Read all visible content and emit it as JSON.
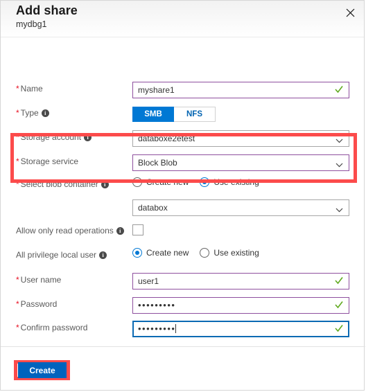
{
  "header": {
    "title": "Add share",
    "subtitle": "mydbg1",
    "close_icon": "close-icon"
  },
  "fields": {
    "name": {
      "label": "Name",
      "required": true,
      "value": "myshare1",
      "placeholder": ""
    },
    "type": {
      "label": "Type",
      "required": true,
      "has_info": true,
      "options": [
        "SMB",
        "NFS"
      ],
      "selected": "SMB"
    },
    "storage_account": {
      "label": "Storage account",
      "required": true,
      "has_info": true,
      "value": "databoxe2etest"
    },
    "storage_service": {
      "label": "Storage service",
      "required": true,
      "has_info": false,
      "value": "Block Blob"
    },
    "blob_container": {
      "label": "Select blob container",
      "required": true,
      "has_info": true,
      "radio_options": [
        "Create new",
        "Use existing"
      ],
      "selected_radio": "Use existing",
      "value": "databox"
    },
    "read_only": {
      "label": "Allow only read operations",
      "required": false,
      "has_info": true,
      "checked": false
    },
    "local_user": {
      "label": "All privilege local user",
      "required": false,
      "has_info": true,
      "radio_options": [
        "Create new",
        "Use existing"
      ],
      "selected_radio": "Create new"
    },
    "user_name": {
      "label": "User name",
      "required": true,
      "value": "user1"
    },
    "password": {
      "label": "Password",
      "required": true,
      "value": "•••••••••"
    },
    "confirm_password": {
      "label": "Confirm password",
      "required": true,
      "value": "•••••••••"
    }
  },
  "footer": {
    "create_label": "Create"
  },
  "colors": {
    "accent_blue": "#0078d4",
    "button_blue": "#0063bd",
    "valid_border": "#8e4f9e",
    "focus_border": "#0b6ab3",
    "required_red": "#e81123",
    "highlight_red": "#fc4b4b",
    "check_green": "#5fa91d"
  },
  "asterisk": "*"
}
